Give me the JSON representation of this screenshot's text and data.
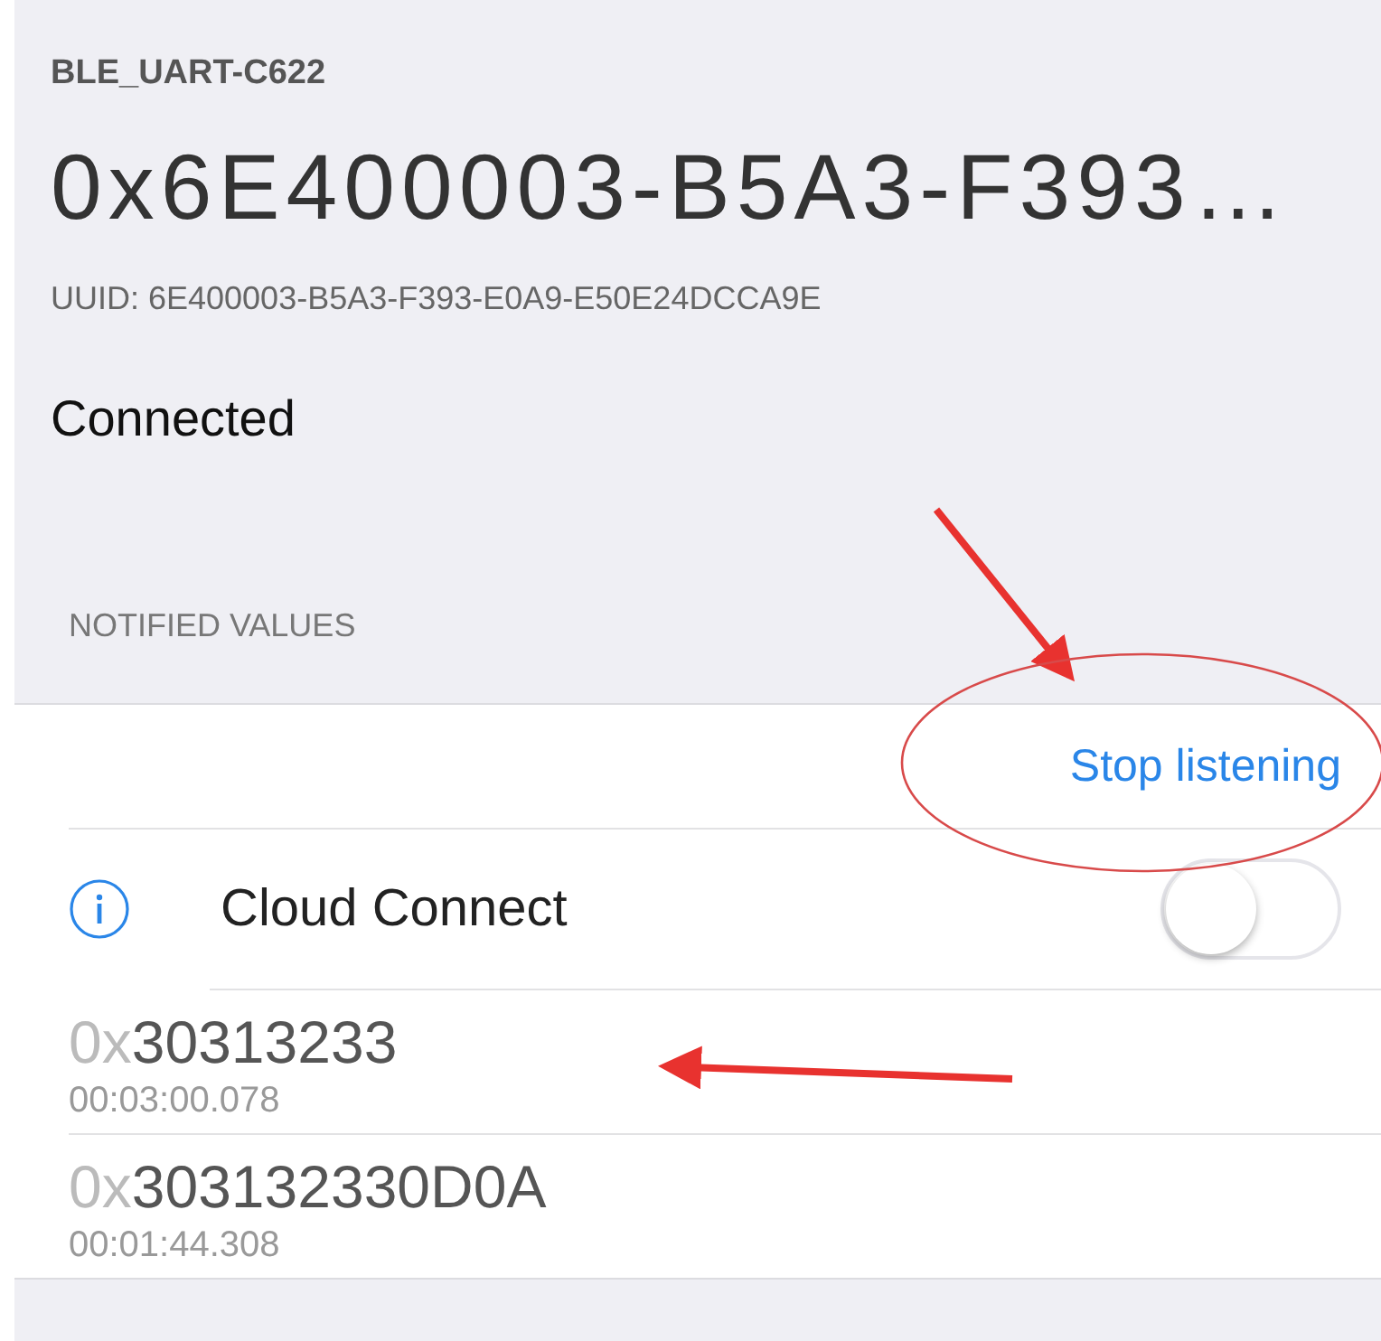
{
  "device_name": "BLE_UART-C622",
  "characteristic_title": "0x6E400003-B5A3-F393…",
  "uuid": "UUID: 6E400003-B5A3-F393-E0A9-E50E24DCCA9E",
  "status": "Connected",
  "section_header": "NOTIFIED VALUES",
  "stop_button": "Stop listening",
  "cloud_connect": {
    "label": "Cloud Connect",
    "on": false
  },
  "values": [
    {
      "prefix": "0x",
      "value": "30313233",
      "time": "00:03:00.078"
    },
    {
      "prefix": "0x",
      "value": "303132330D0A",
      "time": "00:01:44.308"
    }
  ]
}
